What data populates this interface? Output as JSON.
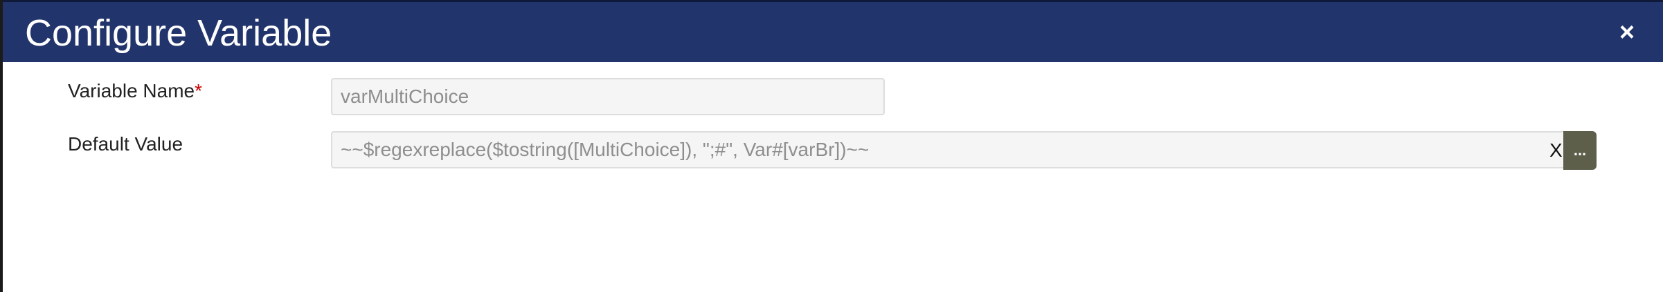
{
  "dialog": {
    "title": "Configure Variable",
    "close_symbol": "×"
  },
  "form": {
    "variable_name": {
      "label": "Variable Name",
      "required_mark": "*",
      "value": "varMultiChoice"
    },
    "default_value": {
      "label": "Default Value",
      "value": "~~$regexreplace($tostring([MultiChoice]), \";#\", Var#[varBr])~~",
      "clear_label": "X",
      "picker_label": "..."
    }
  },
  "colors": {
    "header_bg": "#21346b",
    "required": "#cc0000",
    "picker_bg": "#5e5f4a"
  }
}
